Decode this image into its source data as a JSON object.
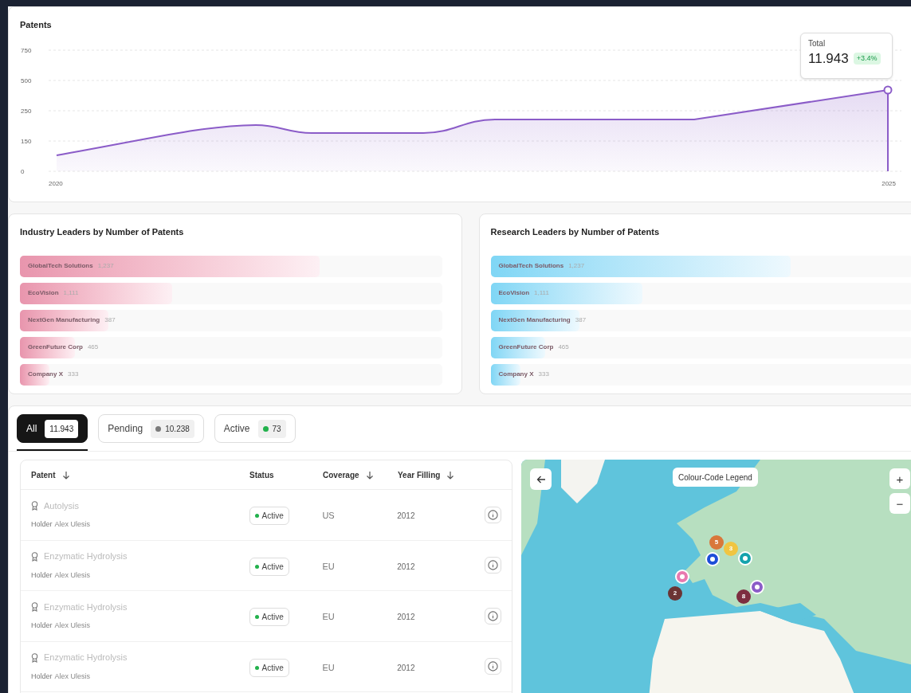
{
  "patents_chart": {
    "title": "Patents",
    "tooltip": {
      "label": "Total",
      "value": "11.943",
      "change": "+3.4%"
    },
    "y_axis_labels": [
      "750",
      "500",
      "250",
      "150",
      "0"
    ],
    "x_axis_labels": [
      "2020",
      "2025"
    ]
  },
  "industry_leaders": {
    "title": "Industry Leaders by Number of Patents",
    "bars": [
      {
        "name": "GlobalTech Solutions",
        "count": "1,237",
        "level": 0.71
      },
      {
        "name": "EcoVision",
        "count": "1,111",
        "level": 0.36
      },
      {
        "name": "NextGen Manufacturing",
        "count": "387",
        "level": 0.21
      },
      {
        "name": "GreenFuture Corp",
        "count": "465",
        "level": 0.13
      },
      {
        "name": "Company X",
        "count": "333",
        "level": 0.07
      }
    ]
  },
  "research_leaders": {
    "title": "Research Leaders by Number of Patents",
    "bars": [
      {
        "name": "GlobalTech Solutions",
        "count": "1,237",
        "level": 0.71
      },
      {
        "name": "EcoVision",
        "count": "1,111",
        "level": 0.36
      },
      {
        "name": "NextGen Manufacturing",
        "count": "387",
        "level": 0.21
      },
      {
        "name": "GreenFuture Corp",
        "count": "465",
        "level": 0.13
      },
      {
        "name": "Company X",
        "count": "333",
        "level": 0.07
      }
    ]
  },
  "tabs": [
    {
      "label": "All",
      "count": "11.943",
      "selected": true
    },
    {
      "label": "Pending",
      "count": "10.238",
      "selected": false,
      "color": "#7a7a7a"
    },
    {
      "label": "Active",
      "count": "73",
      "selected": false,
      "color": "#22b14c"
    }
  ],
  "table": {
    "columns": [
      {
        "label": "Patent",
        "sortable": true
      },
      {
        "label": "Status",
        "sortable": false
      },
      {
        "label": "Coverage",
        "sortable": true
      },
      {
        "label": "Year Filling",
        "sortable": true
      }
    ],
    "rows": [
      {
        "patent": "Autolysis",
        "holder_label": "Holder",
        "holder": "Alex Ulesis",
        "status": "Active",
        "coverage": "US",
        "year": "2012"
      },
      {
        "patent": "Enzymatic Hydrolysis",
        "holder_label": "Holder",
        "holder": "Alex Ulesis",
        "status": "Active",
        "coverage": "EU",
        "year": "2012"
      },
      {
        "patent": "Enzymatic Hydrolysis",
        "holder_label": "Holder",
        "holder": "Alex Ulesis",
        "status": "Active",
        "coverage": "EU",
        "year": "2012"
      },
      {
        "patent": "Enzymatic Hydrolysis",
        "holder_label": "Holder",
        "holder": "Alex Ulesis",
        "status": "Active",
        "coverage": "EU",
        "year": "2012"
      }
    ]
  },
  "map": {
    "legend_button": "Colour-Code Legend",
    "zoom_in": "+",
    "zoom_out": "−",
    "markers": [
      {
        "kind": "cluster",
        "count": "5",
        "color": "#d9773a"
      },
      {
        "kind": "cluster",
        "count": "3",
        "color": "#f0c542"
      },
      {
        "kind": "pin",
        "color": "#1d4ed8"
      },
      {
        "kind": "pin",
        "color": "#14a3ad"
      },
      {
        "kind": "pin",
        "color": "#e879b0"
      },
      {
        "kind": "cluster",
        "count": "2",
        "color": "#6b3434"
      },
      {
        "kind": "cluster",
        "count": "8",
        "color": "#7d2e40"
      },
      {
        "kind": "pin",
        "color": "#8b5cc8"
      }
    ]
  }
}
